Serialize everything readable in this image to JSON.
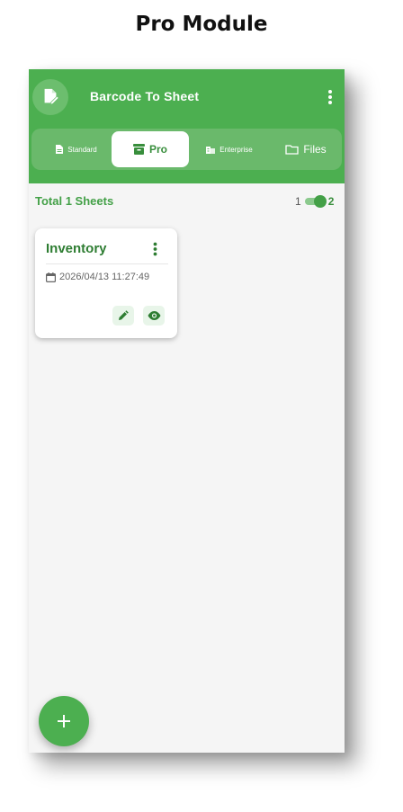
{
  "page": {
    "heading": "Pro Module"
  },
  "app": {
    "title": "Barcode To Sheet",
    "icon": "edit-document-icon",
    "menu_icon": "more-vert-icon",
    "accent_color": "#4caf50"
  },
  "tabs": [
    {
      "label": "Standard",
      "icon": "document-icon",
      "active": false
    },
    {
      "label": "Pro",
      "icon": "archive-box-icon",
      "active": true
    },
    {
      "label": "Enterprise",
      "icon": "building-icon",
      "active": false
    },
    {
      "label": "Files",
      "icon": "folder-icon",
      "active": false
    }
  ],
  "summary": {
    "total_text": "Total 1 Sheets",
    "toggle_left": "1",
    "toggle_right": "2",
    "toggle_on": true
  },
  "sheets": [
    {
      "name": "Inventory",
      "date": "2026/04/13 11:27:49",
      "date_icon": "calendar-icon",
      "actions": [
        {
          "icon": "pencil-icon"
        },
        {
          "icon": "eye-icon"
        }
      ]
    }
  ],
  "fab": {
    "label": "+",
    "icon": "plus-icon"
  }
}
